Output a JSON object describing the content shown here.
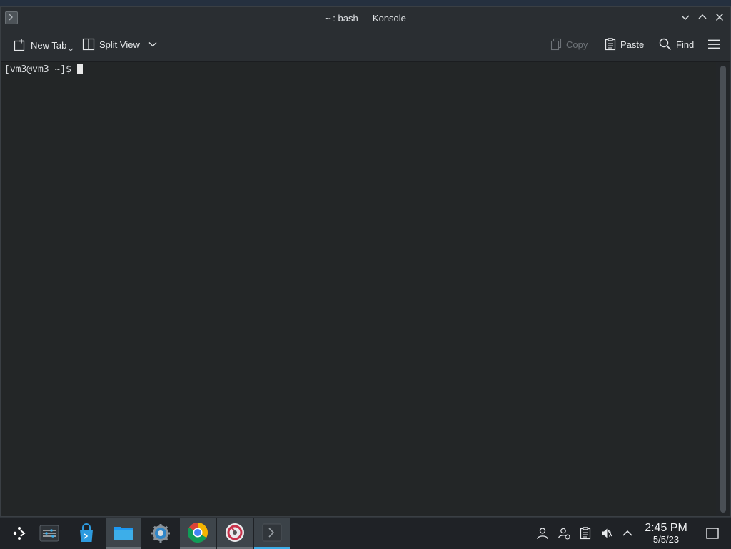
{
  "window": {
    "title": "~ : bash — Konsole"
  },
  "toolbar": {
    "new_tab": "New Tab",
    "split_view": "Split View",
    "copy": "Copy",
    "paste": "Paste",
    "find": "Find"
  },
  "terminal": {
    "prompt": "[vm3@vm3 ~]$"
  },
  "taskbar": {
    "clock_time": "2:45 PM",
    "clock_date": "5/5/23",
    "apps": [
      "app-launcher-icon",
      "system-settings-icon",
      "discover-store-icon",
      "file-manager-icon",
      "settings-gear-icon",
      "chrome-icon",
      "media-app-icon",
      "konsole-icon"
    ]
  },
  "colors": {
    "accent": "#3daee9",
    "terminal_bg": "#232627",
    "titlebar_bg": "#2a2e32"
  }
}
